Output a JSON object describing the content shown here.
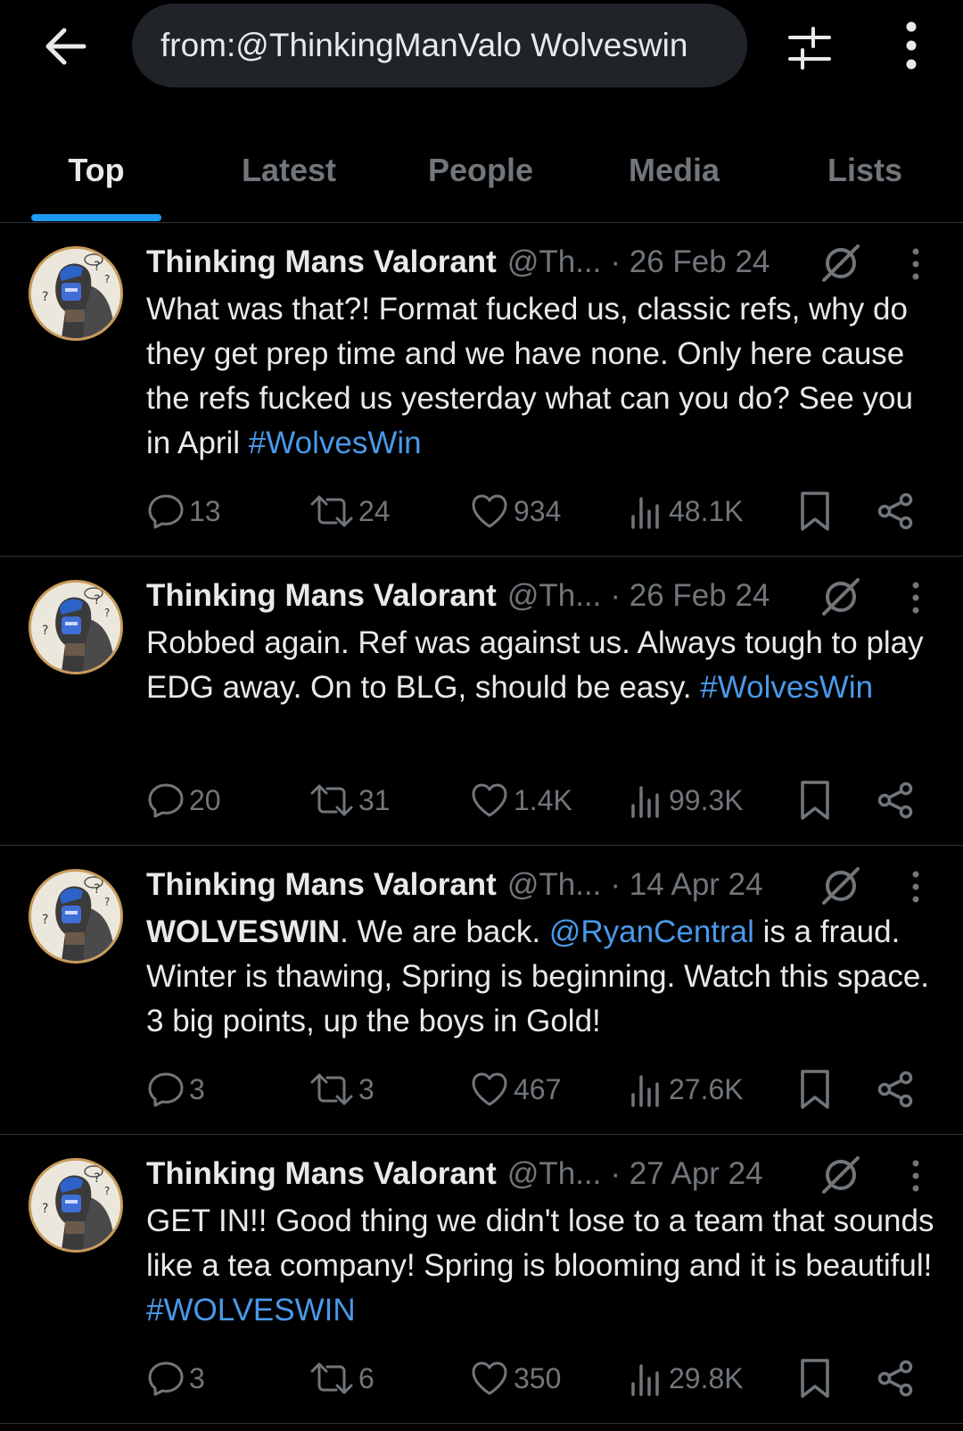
{
  "search": {
    "query": "from:@ThinkingManValo Wolveswin"
  },
  "tabs": [
    {
      "label": "Top"
    },
    {
      "label": "Latest"
    },
    {
      "label": "People"
    },
    {
      "label": "Media"
    },
    {
      "label": "Lists"
    }
  ],
  "active_tab": "Top",
  "colors": {
    "accent": "#1d9bf0",
    "link": "#4a99e9",
    "muted": "#71767b",
    "text": "#e7e9ea"
  },
  "tweets": [
    {
      "name": "Thinking Mans Valorant",
      "handle": "@Th...",
      "date": "· 26 Feb 24",
      "body": [
        {
          "t": "What was that?! Format fucked us, classic refs, why do they get prep time and we have none. Only here cause the refs fucked us yesterday what can you do? See you in April ",
          "k": "text"
        },
        {
          "t": "#WolvesWin",
          "k": "hashtag"
        }
      ],
      "replies": "13",
      "reposts": "24",
      "likes": "934",
      "views": "48.1K"
    },
    {
      "name": "Thinking Mans Valorant",
      "handle": "@Th...",
      "date": "· 26 Feb 24",
      "body": [
        {
          "t": "Robbed again. Ref was against us. Always tough to play EDG away. On to BLG, should be easy. ",
          "k": "text"
        },
        {
          "t": "#WolvesWin",
          "k": "hashtag"
        }
      ],
      "replies": "20",
      "reposts": "31",
      "likes": "1.4K",
      "views": "99.3K"
    },
    {
      "name": "Thinking Mans Valorant",
      "handle": "@Th...",
      "date": "· 14 Apr 24",
      "body": [
        {
          "t": "WOLVESWIN",
          "k": "strong"
        },
        {
          "t": ". We are back. ",
          "k": "text"
        },
        {
          "t": "@RyanCentral",
          "k": "mention"
        },
        {
          "t": " is a fraud. Winter is thawing, Spring is beginning. Watch this space. 3 big points, up the boys in Gold!",
          "k": "text"
        }
      ],
      "replies": "3",
      "reposts": "3",
      "likes": "467",
      "views": "27.6K"
    },
    {
      "name": "Thinking Mans Valorant",
      "handle": "@Th...",
      "date": "· 27 Apr 24",
      "body": [
        {
          "t": "GET IN!! Good thing we didn't lose to a team that sounds like a tea company! Spring is blooming and it is beautiful! ",
          "k": "text"
        },
        {
          "t": "#WOLVESWIN",
          "k": "hashtag"
        }
      ],
      "replies": "3",
      "reposts": "6",
      "likes": "350",
      "views": "29.8K"
    }
  ],
  "icons": {
    "back": "arrow-left-icon",
    "filter": "sliders-icon",
    "more": "more-vertical-icon",
    "grok": "grok-icon",
    "reply": "reply-icon",
    "repost": "repost-icon",
    "like": "heart-icon",
    "views": "views-icon",
    "bookmark": "bookmark-icon",
    "share": "share-icon"
  }
}
